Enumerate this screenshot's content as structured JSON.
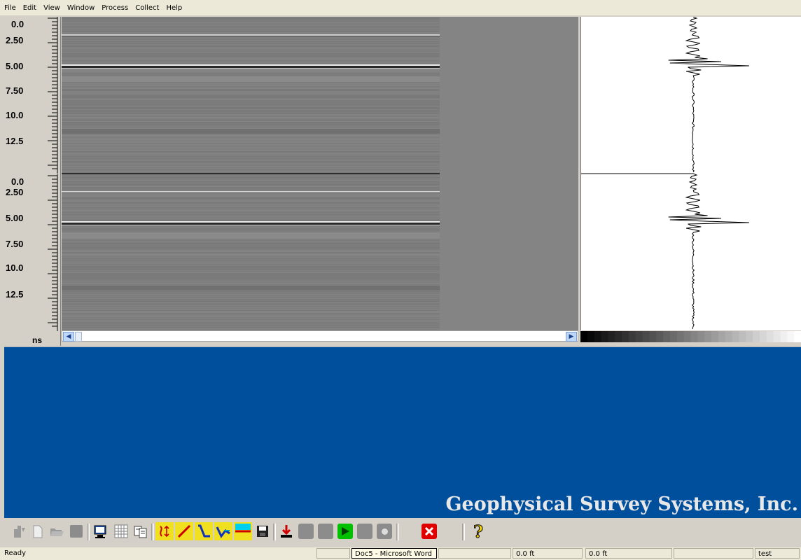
{
  "menu": [
    "File",
    "Edit",
    "View",
    "Window",
    "Process",
    "Collect",
    "Help"
  ],
  "ruler": {
    "ticks": [
      "0.0",
      "2.50",
      "5.00",
      "7.50",
      "10.0",
      "12.5"
    ],
    "unit": "ns"
  },
  "branding": {
    "company": "Geophysical Survey Systems, Inc."
  },
  "toolbar": {
    "buttons": [
      "new-file-icon",
      "new-document-icon",
      "open-folder-icon",
      "disabled-button",
      "monitor-icon",
      "grid-icon",
      "copy-icon",
      "position-marker-icon",
      "linear-gain-icon",
      "range-gain-icon",
      "filter-gain-icon",
      "horizontal-line-icon",
      "save-icon",
      "download-icon",
      "disabled-button",
      "disabled-button",
      "play-icon",
      "disabled-button",
      "record-icon",
      "stop-icon",
      "help-icon"
    ]
  },
  "status": {
    "ready": "Ready",
    "taskbar_tooltip": "Doc5 - Microsoft Word",
    "position1": "0.0 ft",
    "position2": "0.0 ft",
    "project": "test"
  },
  "colors": {
    "background_blue": "#004f9d",
    "radargram_gray": "#848484",
    "play_green": "#00c000",
    "stop_red": "#e00000"
  }
}
